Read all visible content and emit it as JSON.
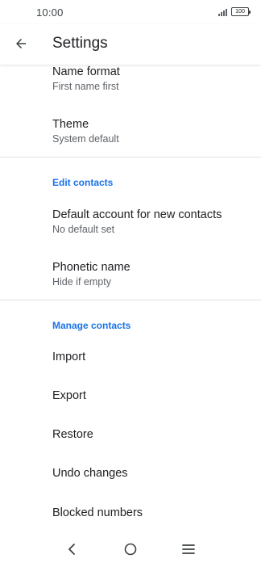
{
  "status_bar": {
    "time": "10:00",
    "battery_level": "100"
  },
  "app_bar": {
    "title": "Settings",
    "back_icon": "arrow-back-icon"
  },
  "preferences": [
    {
      "title": "Name format",
      "summary": "First name first"
    },
    {
      "title": "Theme",
      "summary": "System default"
    }
  ],
  "edit_contacts": {
    "header": "Edit contacts",
    "items": [
      {
        "title": "Default account for new contacts",
        "summary": "No default set"
      },
      {
        "title": "Phonetic name",
        "summary": "Hide if empty"
      }
    ]
  },
  "manage_contacts": {
    "header": "Manage contacts",
    "items": [
      "Import",
      "Export",
      "Restore",
      "Undo changes",
      "Blocked numbers"
    ]
  },
  "nav_bar": {
    "back_icon": "nav-back-icon",
    "home_icon": "nav-home-icon",
    "menu_icon": "nav-menu-icon"
  },
  "colors": {
    "accent": "#1a73e8",
    "text_primary": "#202124",
    "text_secondary": "#5f6368"
  }
}
